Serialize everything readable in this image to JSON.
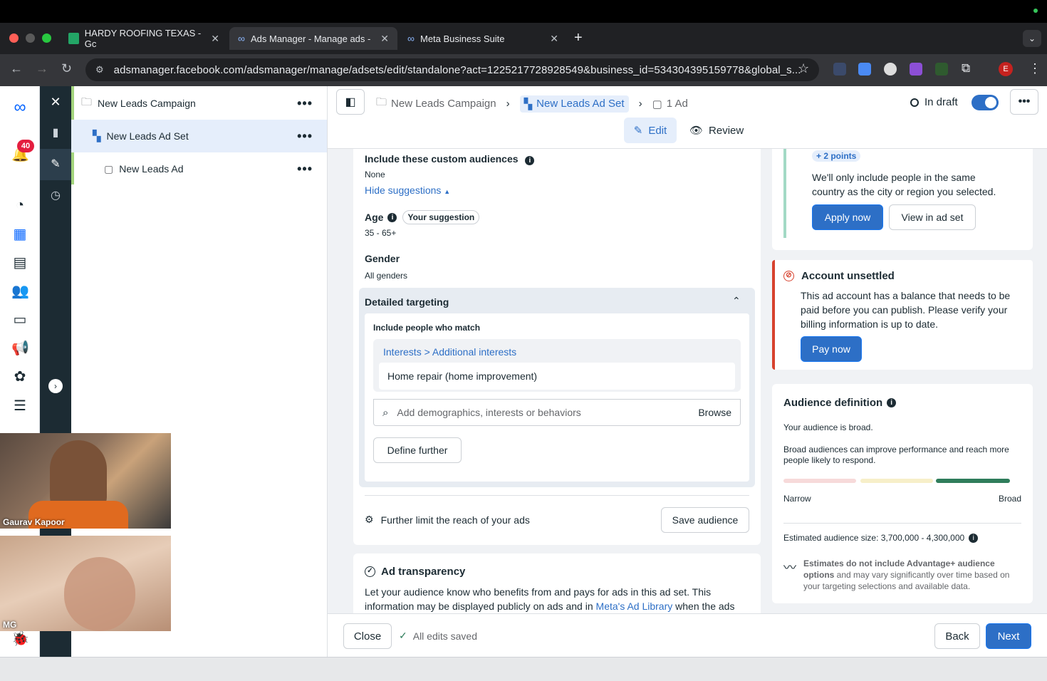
{
  "browser": {
    "tabs": [
      {
        "label": "HARDY ROOFING TEXAS - Gc",
        "icon": "sheets-icon"
      },
      {
        "label": "Ads Manager - Manage ads -",
        "icon": "meta-icon"
      },
      {
        "label": "Meta Business Suite",
        "icon": "meta-icon"
      }
    ],
    "url": "adsmanager.facebook.com/adsmanager/manage/adsets/edit/standalone?act=1225217728928549&business_id=534304395159778&global_s...",
    "profile_initial": "E"
  },
  "leftnav": {
    "notification_count": "40"
  },
  "tree": {
    "campaign": "New Leads Campaign",
    "adset": "New Leads Ad Set",
    "ad": "New Leads Ad"
  },
  "header": {
    "breadcrumb": {
      "campaign": "New Leads Campaign",
      "adset": "New Leads Ad Set",
      "ad": "1 Ad"
    },
    "status": "In draft",
    "edit_label": "Edit",
    "review_label": "Review"
  },
  "audience": {
    "custom_title": "Include these custom audiences",
    "custom_value": "None",
    "hide_suggestions": "Hide suggestions",
    "age_label": "Age",
    "age_badge": "Your suggestion",
    "age_value": "35 - 65+",
    "gender_label": "Gender",
    "gender_value": "All genders",
    "detailed_title": "Detailed targeting",
    "include_label": "Include people who match",
    "interest_path": "Interests > Additional interests",
    "interest_item": "Home repair (home improvement)",
    "search_placeholder": "Add demographics, interests or behaviors",
    "browse_label": "Browse",
    "define_further": "Define further",
    "further_limit": "Further limit the reach of your ads",
    "save_audience": "Save audience"
  },
  "transparency": {
    "title": "Ad transparency",
    "text_1": "Let your audience know who benefits from and pays for ads in this ad set. This",
    "text_2": "information may be displayed publicly on ads and in",
    "link": "Meta's Ad Library",
    "text_3": "when the ads"
  },
  "suggestion_card": {
    "points": "+ 2 points",
    "text_1": "We'll only include people in the same",
    "text_2": "country as the city or region you selected.",
    "apply": "Apply now",
    "view": "View in ad set"
  },
  "account_card": {
    "title": "Account unsettled",
    "text_1": "This ad account has a balance that needs to be",
    "text_2": "paid before you can publish. Please verify your",
    "text_3": "billing information is up to date.",
    "pay": "Pay now"
  },
  "definition_card": {
    "title": "Audience definition",
    "broad_text": "Your audience is broad.",
    "info_1": "Broad audiences can improve performance and reach more",
    "info_2": "people likely to respond.",
    "narrow": "Narrow",
    "broad": "Broad",
    "estimate": "Estimated audience size: 3,700,000 - 4,300,000",
    "note_bold_1": "Estimates do not include Advantage+ audience",
    "note_bold_2": "options",
    "note_1": "and may vary significantly over time based on",
    "note_2": "your targeting selections and available data."
  },
  "footer": {
    "close": "Close",
    "saved": "All edits saved",
    "back": "Back",
    "next": "Next"
  },
  "video": {
    "person_1": "Gaurav Kapoor",
    "person_2": "MG"
  },
  "colors": {
    "accent": "#2d6fc6",
    "danger": "#d7422e",
    "success": "#2f7d5b"
  }
}
